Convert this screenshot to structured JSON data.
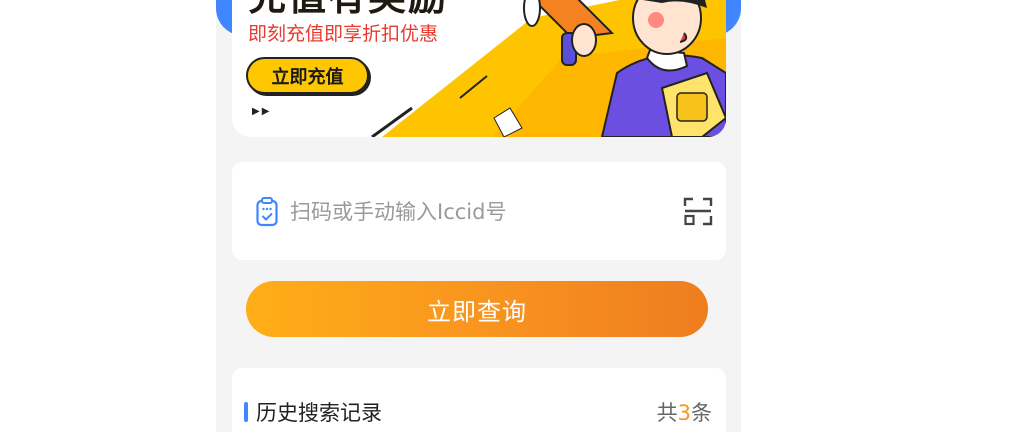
{
  "banner": {
    "title": "充值有奖励",
    "subtitle": "即刻充值即享折扣优惠",
    "button_label": "立即充值",
    "arrows": "▶▶"
  },
  "search": {
    "placeholder": "扫码或手动输入Iccid号",
    "value": ""
  },
  "query_button": {
    "label": "立即查询"
  },
  "history": {
    "title": "历史搜索记录",
    "count_prefix": "共",
    "count": "3",
    "count_suffix": "条"
  },
  "icons": {
    "doc": "document-check-icon",
    "scan": "scan-icon"
  },
  "colors": {
    "accent_blue": "#3f86ff",
    "accent_orange": "#f7951f",
    "banner_red": "#e63b2e",
    "banner_yellow": "#ffc700"
  }
}
